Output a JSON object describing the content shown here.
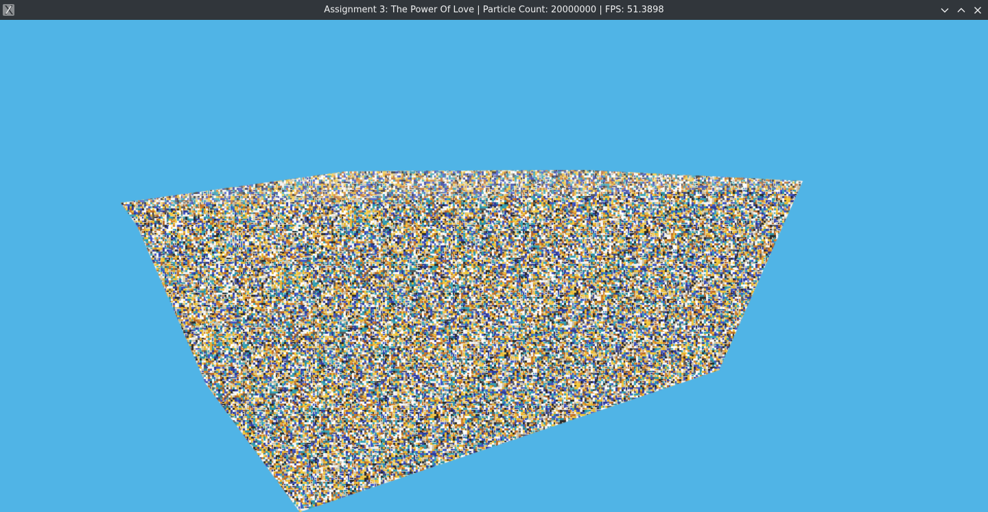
{
  "window": {
    "title": "Assignment 3: The Power Of Love | Particle Count: 20000000 | FPS: 51.3898",
    "app_icon": "x-window-icon",
    "controls": {
      "minimize_icon": "chevron-down-icon",
      "maximize_icon": "chevron-up-icon",
      "close_icon": "close-icon"
    }
  },
  "scene": {
    "background_color": "#50b4e6",
    "object": "particle-box",
    "particle_palette": [
      "#ffffff",
      "#f2f2f2",
      "#2f3b9a",
      "#3f55c8",
      "#2b93a8",
      "#3aa6b8",
      "#e8b830",
      "#f4cc40",
      "#b86a2a",
      "#d4842e",
      "#2a2a2a",
      "#5a5a5a",
      "#c8c0a8"
    ]
  }
}
